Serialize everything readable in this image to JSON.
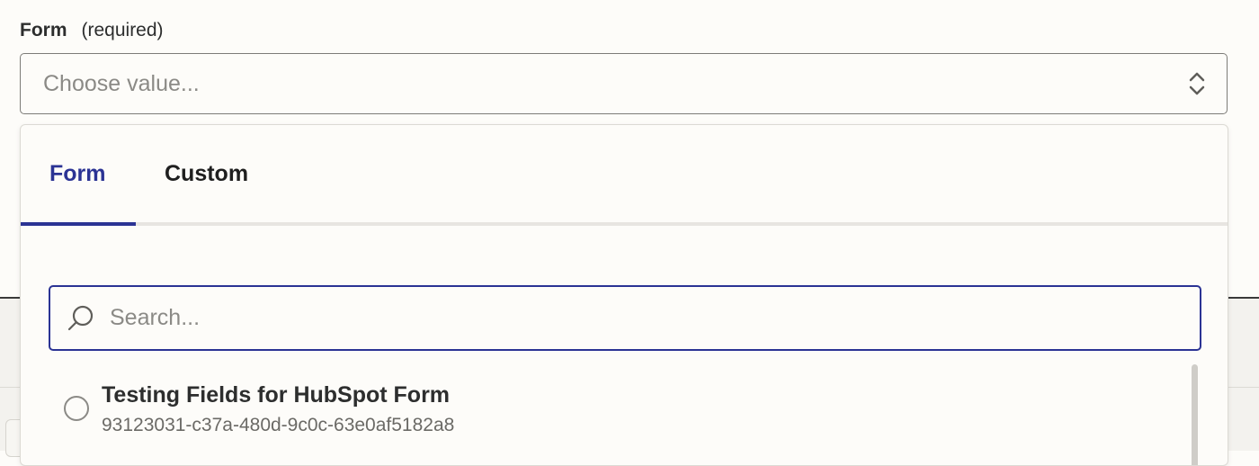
{
  "field": {
    "label": "Form",
    "required_text": "(required)",
    "placeholder": "Choose value..."
  },
  "dropdown": {
    "tabs": [
      {
        "label": "Form",
        "active": true
      },
      {
        "label": "Custom",
        "active": false
      }
    ],
    "search": {
      "placeholder": "Search...",
      "value": ""
    },
    "options": [
      {
        "title": "Testing Fields for HubSpot Form",
        "id": "93123031-c37a-480d-9c0c-63e0af5182a8",
        "selected": false
      }
    ]
  },
  "colors": {
    "accent": "#2b3394",
    "background": "#fdfcf9",
    "border": "#7d7c78",
    "muted_text": "#8b8a86"
  },
  "icons": {
    "select_indicator": "chevron-up-down-icon",
    "search": "search-icon",
    "radio": "radio-unchecked-icon"
  }
}
